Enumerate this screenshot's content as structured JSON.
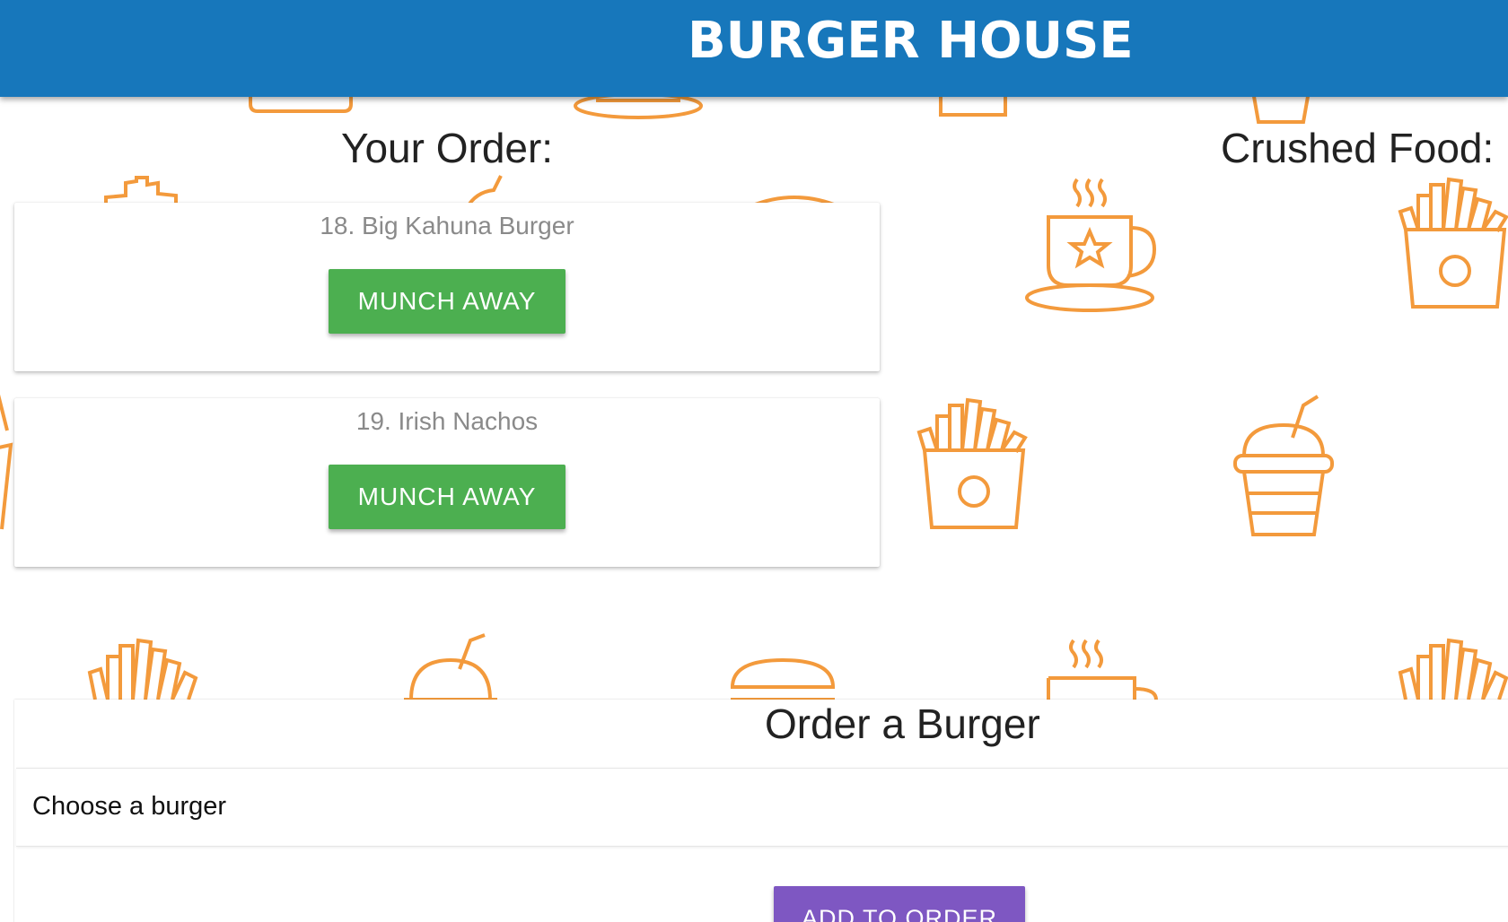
{
  "header": {
    "brand": "BURGER HOUSE"
  },
  "orders_section": {
    "heading": "Your Order:",
    "items": [
      {
        "name": "18. Big Kahuna Burger",
        "button_label": "MUNCH AWAY"
      },
      {
        "name": "19. Irish Nachos",
        "button_label": "MUNCH AWAY"
      }
    ]
  },
  "crushed_section": {
    "heading": "Crushed Food:"
  },
  "order_form": {
    "title": "Order a Burger",
    "select_value": "Choose a burger",
    "submit_label": "ADD TO ORDER"
  },
  "colors": {
    "header_bg": "#1777bb",
    "munch_button": "#4caf50",
    "add_button": "#7e57c2",
    "pattern_stroke": "#f39a3c"
  },
  "background_icons": [
    "fries-icon",
    "coffee-cup-icon",
    "drink-cup-icon",
    "burger-icon"
  ]
}
